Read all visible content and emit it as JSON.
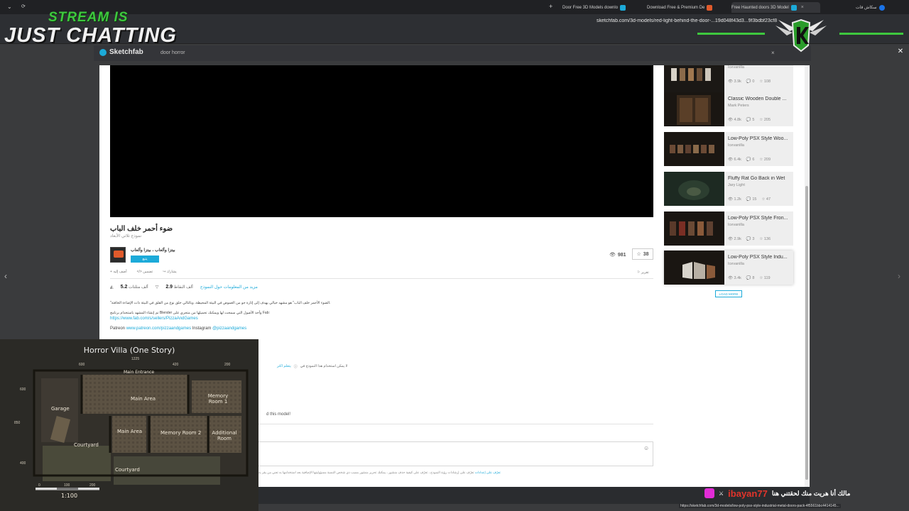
{
  "browser": {
    "tabs": [
      {
        "label": "Door Free 3D Models downlo",
        "favicon_color": "#1caad9"
      },
      {
        "label": "Download Free & Premium De",
        "favicon_color": "#e05a2b"
      },
      {
        "label": "Free Haunted doors 3D Model",
        "favicon_color": "#1caad9"
      },
      {
        "label": "سكاش قات",
        "favicon_color": "#1a73e8"
      }
    ],
    "new_tab": "+",
    "address": "sketchfab.com/3d-models/red-light-behind-the-door-...19d048f43d3...9f3bdbf23cf8"
  },
  "overlay": {
    "stream_is": "STREAM IS",
    "just_chatting": "JUST CHATTING",
    "accent_green": "#3ec83e"
  },
  "sketchfab": {
    "brand": "Sketchfab",
    "search_value": "door horror",
    "clear": "×"
  },
  "model": {
    "title": "ضوء أحمر خلف الباب",
    "subtitle": "نموذج ثلاثي الأبعاد",
    "author": "بيتزا وألعاب ، بيتزا وألعاب",
    "follow": "يتبع",
    "views": "981",
    "likes": "38",
    "actions": [
      "أضف إليه",
      "تضمين",
      "يشارك"
    ],
    "report": "تقرير",
    "stats": {
      "triangles_value": "5.2",
      "triangles_label": "ألف مثلثات",
      "vertices_value": "2.9",
      "vertices_label": "ألف النقاط",
      "more_info": "مزيد من المعلومات حول النموذج"
    },
    "description": [
      "\"الضوء الأحمر خلف الباب\" هو مشهد خيالي يهدف إلى إثارة جو من الغموض في البيئة المحيطة، وبالتالي خلق نوع من القلق في البيئة ذات الإضاءة الخافتة.",
      "تم إنشاء المشهد باستخدام برنامج Blender وأخذ الأصول التي سمحت لها ويمكنك تحميلها من متجري على Fab:"
    ],
    "fab_link": "https://www.fab.com/s/sellers/PizzaAndGames",
    "patreon_label": "Patreon",
    "patreon_link": "www.patreon.com/pizzaandgames",
    "instagram_label": "Instagram",
    "instagram_handle": "@pizzaandgames",
    "license_note": "لا يمكن استخدام هذا النموذج في",
    "learn_more": "يتعلم اكثر",
    "comment_prompt": "d this model!",
    "terms_text": "تعرّف على إرشادات رؤية النموذج ، تعرّف على كيفية حذف منشور ، يمكنك تحرير منشور بسبب ذي شخص النسبة مسؤوليتها الإضافية بعد استخدامها به تعني من يقر به",
    "terms_link": "تعرّف على إعدادات"
  },
  "related": [
    {
      "name": "",
      "author": "Icevanilla",
      "views": "3.9k",
      "comments": "0",
      "likes": "108",
      "thumb": "#d8d2c8"
    },
    {
      "name": "Classic Wooden Double ...",
      "author": "Mark Peters",
      "views": "4.8k",
      "comments": "5",
      "likes": "205",
      "thumb": "#3a2a1c"
    },
    {
      "name": "Low-Poly PSX Style Woo...",
      "author": "Icevanilla",
      "views": "6.4k",
      "comments": "6",
      "likes": "209",
      "thumb": "#141210"
    },
    {
      "name": "Fluffy Rat Go Back in Wet",
      "author": "Jary Light",
      "views": "1.2k",
      "comments": "15",
      "likes": "47",
      "thumb": "#1d2a22"
    },
    {
      "name": "Low-Poly PSX Style Fron...",
      "author": "Icevanilla",
      "views": "2.9k",
      "comments": "3",
      "likes": "136",
      "thumb": "#161312"
    },
    {
      "name": "Low-Poly PSX Style Indu...",
      "author": "Icevanilla",
      "views": "3.4k",
      "comments": "8",
      "likes": "119",
      "thumb": "#0e0e0e"
    }
  ],
  "load_more": "LOAD MORE",
  "floorplan": {
    "title": "Horror Villa (One Story)",
    "rooms": [
      "Main Entrance",
      "Main Area",
      "Memory Room 1",
      "Garage",
      "Main Area",
      "Memory Room 2",
      "Additional Room",
      "Courtyard",
      "Courtyard"
    ],
    "dims_top": [
      "1225",
      "600",
      "420",
      "200"
    ],
    "dims_left": [
      "600",
      "850",
      "400"
    ],
    "scale_ticks": [
      "0",
      "100",
      "200"
    ],
    "scale": "1:100"
  },
  "chat": {
    "user": "ibayan77",
    "message": "مالك أنا هريت منك لحقتني هنا"
  },
  "status_url": "https://sketchfab.com/3d-models/low-poly-psx-style-industrial-metal-doors-pack-4f5561bbc4414145..."
}
